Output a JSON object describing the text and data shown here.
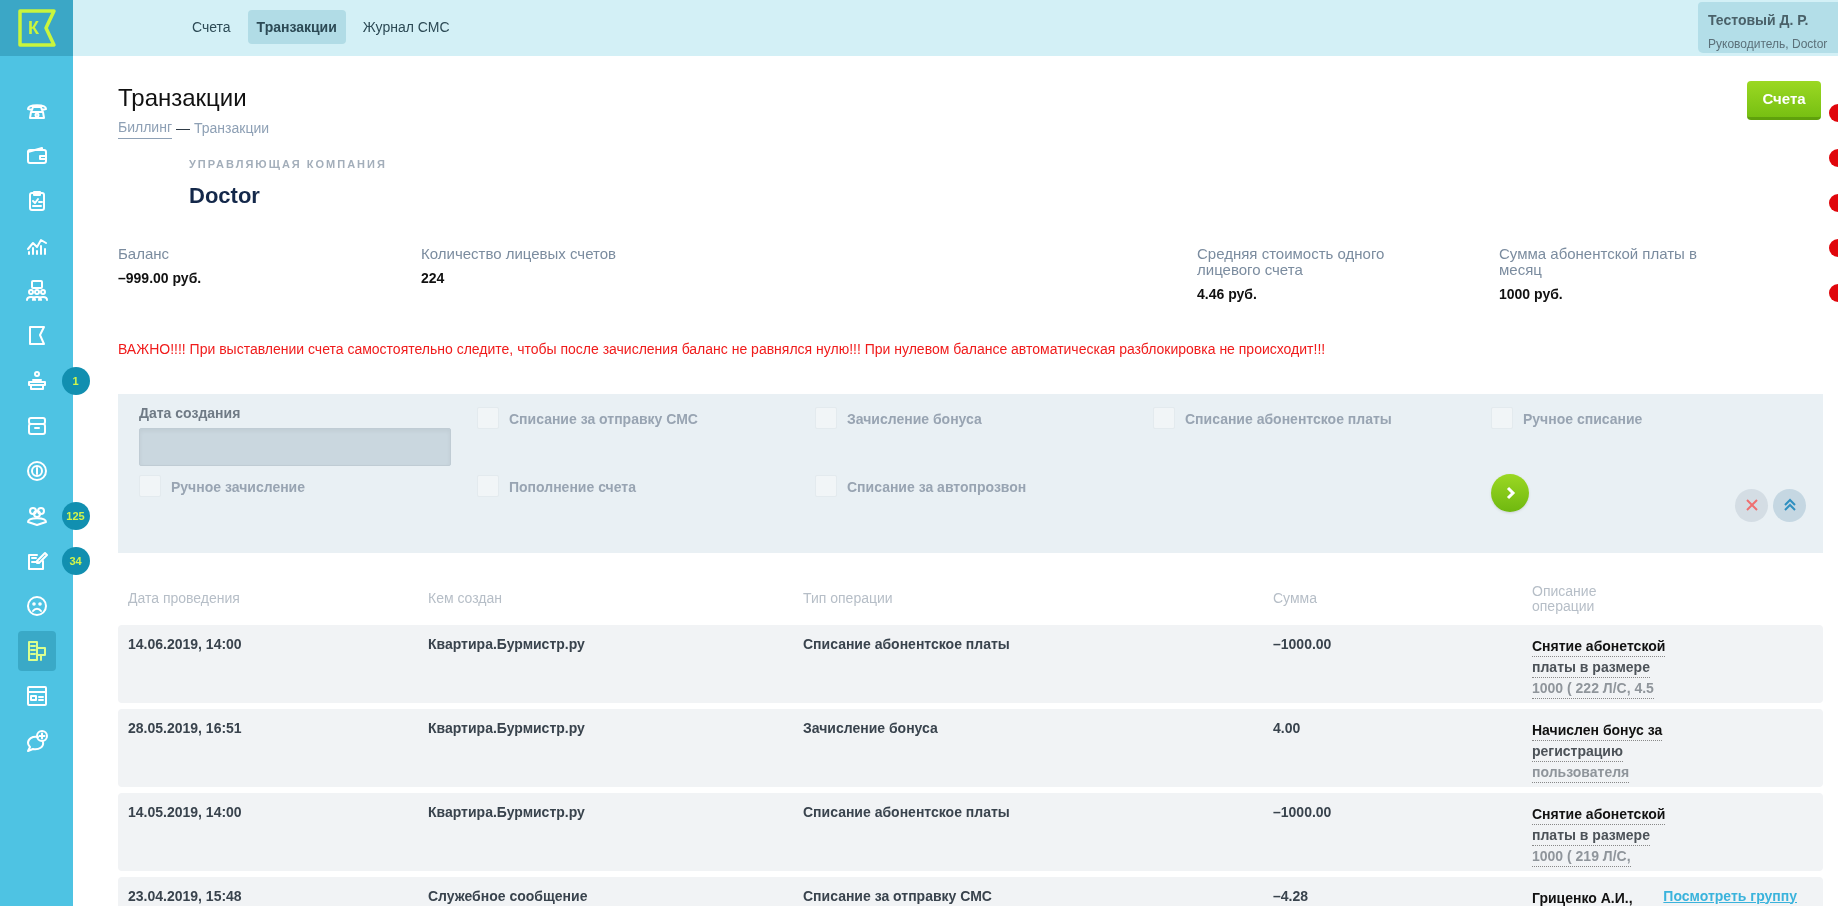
{
  "logo": "К",
  "sidebar": {
    "items": [
      {
        "selected": false
      },
      {
        "selected": false
      },
      {
        "selected": false
      },
      {
        "selected": false
      },
      {
        "selected": false
      },
      {
        "selected": false
      },
      {
        "selected": false,
        "badge": "1"
      },
      {
        "selected": false
      },
      {
        "selected": false
      },
      {
        "selected": false,
        "badge": "125"
      },
      {
        "selected": false,
        "badge": "34"
      },
      {
        "selected": false
      },
      {
        "selected": true
      },
      {
        "selected": false
      },
      {
        "selected": false
      }
    ]
  },
  "tabs": [
    {
      "label": "Счета",
      "selected": false
    },
    {
      "label": "Транзакции",
      "selected": true
    },
    {
      "label": "Журнал СМС",
      "selected": false
    }
  ],
  "user": {
    "name": "Тестовый Д. Р.",
    "role": "Руководитель, Doctor"
  },
  "title": "Транзакции",
  "breadcrumb": {
    "link": "Биллинг",
    "separator": "—",
    "current": "Транзакции"
  },
  "action_button": "Счета",
  "company": {
    "label": "УПРАВЛЯЮЩАЯ КОМПАНИЯ",
    "name": "Doctor"
  },
  "stats": [
    {
      "label": "Баланс",
      "value": "–999.00 руб."
    },
    {
      "label": "Количество лицевых счетов",
      "value": "224"
    },
    {
      "label": "Средняя стоимость одного лицевого счета",
      "value": "4.46 руб."
    },
    {
      "label": "Сумма абонентской платы в месяц",
      "value": "1000 руб."
    }
  ],
  "warning": "ВАЖНО!!!! При выставлении счета самостоятельно следите, чтобы после зачисления баланс не равнялся нулю!!! При нулевом балансе автоматическая разблокировка не происходит!!!",
  "filter": {
    "date_label": "Дата создания",
    "options": [
      {
        "label": "Списание за отправку СМС",
        "checked": false
      },
      {
        "label": "Зачисление бонуса",
        "checked": false
      },
      {
        "label": "Списание абонентское платы",
        "checked": false
      },
      {
        "label": "Ручное списание",
        "checked": false
      },
      {
        "label": "Ручное зачисление",
        "checked": false
      },
      {
        "label": "Пополнение счета",
        "checked": false
      },
      {
        "label": "Списание за автопрозвон",
        "checked": false
      }
    ]
  },
  "table": {
    "columns": [
      "Дата проведения",
      "Кем создан",
      "Тип операции",
      "Сумма",
      "Описание операции"
    ],
    "rows": [
      {
        "date": "14.06.2019, 14:00",
        "author": "Квартира.Бурмистр.ру",
        "type": "Списание абонентское платы",
        "amount": "–1000.00",
        "description": [
          "Снятие абонетской",
          "платы в размере",
          "1000 ( 222 Л/С, 4.5"
        ]
      },
      {
        "date": "28.05.2019, 16:51",
        "author": "Квартира.Бурмистр.ру",
        "type": "Зачисление бонуса",
        "amount": "4.00",
        "description": [
          "Начислен бонус за",
          "регистрацию",
          "пользователя"
        ]
      },
      {
        "date": "14.05.2019, 14:00",
        "author": "Квартира.Бурмистр.ру",
        "type": "Списание абонентское платы",
        "amount": "–1000.00",
        "description": [
          "Снятие абонетской",
          "платы в размере",
          "1000 ( 219 Л/С,"
        ]
      },
      {
        "date": "23.04.2019, 15:48",
        "author": "Служебное сообщение",
        "type": "Списание за отправку СМС",
        "amount": "–4.28",
        "description": [
          "Гриценко А.И.,"
        ],
        "link": "Посмотреть группу"
      }
    ]
  }
}
